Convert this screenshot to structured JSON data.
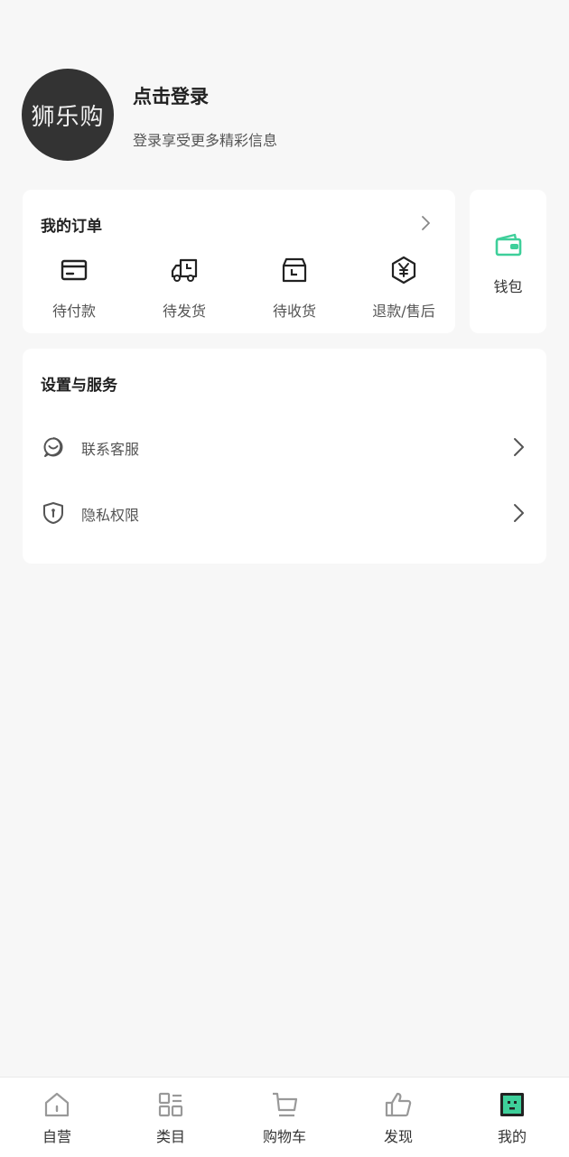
{
  "profile": {
    "avatar_text": "狮乐购",
    "login_title": "点击登录",
    "login_subtitle": "登录享受更多精彩信息"
  },
  "orders": {
    "title": "我的订单",
    "items": [
      {
        "label": "待付款",
        "icon": "card-payment-icon"
      },
      {
        "label": "待发货",
        "icon": "delivery-truck-icon"
      },
      {
        "label": "待收货",
        "icon": "package-box-icon"
      },
      {
        "label": "退款/售后",
        "icon": "yuan-shield-icon"
      }
    ]
  },
  "wallet": {
    "label": "钱包",
    "icon": "wallet-icon",
    "accent_color": "#3ecf9a"
  },
  "services": {
    "title": "设置与服务",
    "items": [
      {
        "label": "联系客服",
        "icon": "customer-service-icon"
      },
      {
        "label": "隐私权限",
        "icon": "privacy-shield-icon"
      }
    ]
  },
  "tabbar": {
    "tabs": [
      {
        "label": "自营",
        "icon": "home-icon"
      },
      {
        "label": "类目",
        "icon": "category-grid-icon"
      },
      {
        "label": "购物车",
        "icon": "cart-icon"
      },
      {
        "label": "发现",
        "icon": "thumbs-up-icon"
      },
      {
        "label": "我的",
        "icon": "profile-face-icon",
        "active": true
      }
    ]
  },
  "colors": {
    "background": "#f7f7f7",
    "card": "#ffffff",
    "avatar_bg": "#333333",
    "accent": "#3ecf9a"
  }
}
